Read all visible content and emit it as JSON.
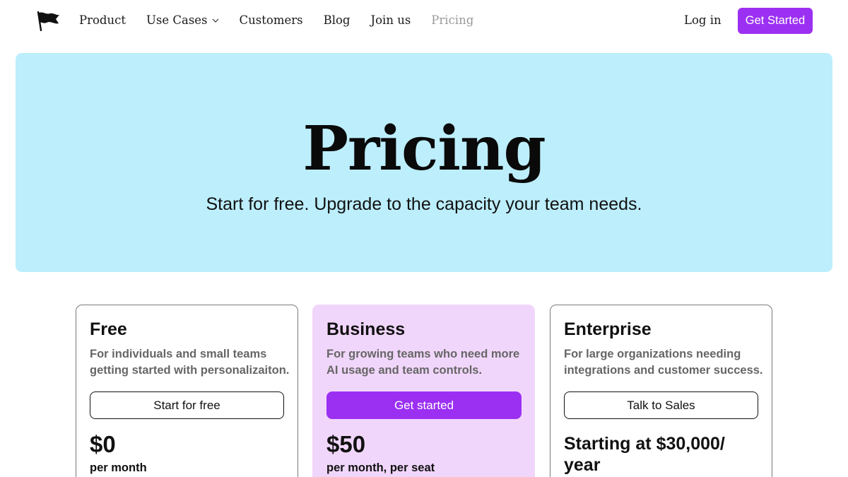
{
  "nav": {
    "logo_icon": "flag-icon",
    "links": [
      {
        "label": "Product"
      },
      {
        "label": "Use Cases"
      },
      {
        "label": "Customers"
      },
      {
        "label": "Blog"
      },
      {
        "label": "Join us"
      },
      {
        "label": "Pricing"
      }
    ],
    "login_label": "Log in",
    "cta_label": "Get Started"
  },
  "hero": {
    "title": "Pricing",
    "subtitle": "Start for free. Upgrade to the capacity your team needs."
  },
  "plans": [
    {
      "name": "Free",
      "description": "For individuals and small teams getting started with personalizaiton.",
      "button_label": "Start for free",
      "price": "$0",
      "period": "per month"
    },
    {
      "name": "Business",
      "description": "For growing teams who need more AI usage and team controls.",
      "button_label": "Get started",
      "price": "$50",
      "period": "per month, per seat"
    },
    {
      "name": "Enterprise",
      "description": "For large organizations needing integrations and customer success.",
      "button_label": "Talk to Sales",
      "price": "Starting at $30,000/ year"
    }
  ],
  "colors": {
    "accent": "#9b30f2",
    "hero_bg": "#bdeefc",
    "featured_card_bg": "#f1d6fb",
    "muted_nav": "#9a9a9a"
  }
}
